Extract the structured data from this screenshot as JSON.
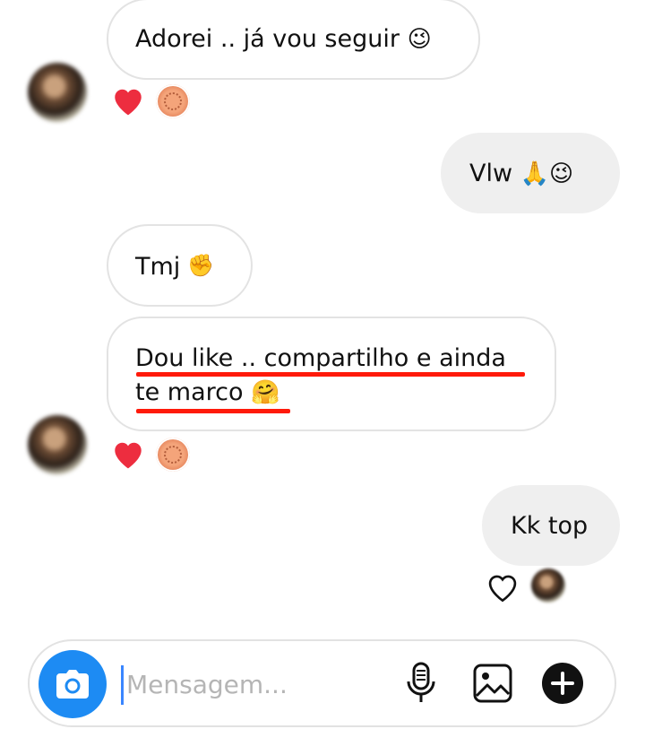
{
  "messages": [
    {
      "side": "in",
      "text": "Adorei .. já vou seguir",
      "emoji": "😉"
    },
    {
      "side": "out",
      "text": "Vlw",
      "emoji": "🙏😉"
    },
    {
      "side": "in",
      "text": "Tmj",
      "emoji": "✊"
    },
    {
      "side": "in",
      "line1": "Dou like .. compartilho e ainda",
      "line2": "te marco",
      "emoji": "🤗"
    },
    {
      "side": "out",
      "text": "Kk top"
    }
  ],
  "composer": {
    "placeholder": "Mensagem..."
  },
  "colors": {
    "accent": "#1d8bf3",
    "heart": "#ed2d3f",
    "underline": "#ff1a0a",
    "outgoing_bubble": "#efefef"
  },
  "icons": {
    "camera": "camera-icon",
    "mic": "microphone-icon",
    "gallery": "gallery-icon",
    "add": "plus-icon"
  }
}
